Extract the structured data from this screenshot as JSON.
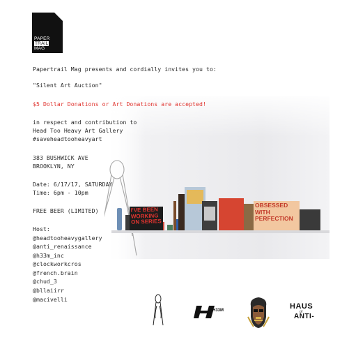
{
  "logo": {
    "line1": "PAPER",
    "line2": "TRAIL",
    "line3": "MAG"
  },
  "intro": "Papertrail Mag presents and cordially invites you to:",
  "event_title": "\"Silent Art Auction\"",
  "donation_note": "$5 Dollar Donations or Art Donations are accepted!",
  "purpose": [
    "in respect and contribution to",
    "Head Too Heavy Art Gallery",
    "#saveheadtooheavyart"
  ],
  "address": [
    "383 BUSHWICK AVE",
    "BROOKLYN, NY"
  ],
  "schedule": [
    "Date: 6/17/17, SATURDAY",
    "Time: 6pm - 10pm"
  ],
  "beer": "FREE BEER (LIMITED)",
  "hosts_label": "Host:",
  "hosts": [
    "@headtooheavygallery",
    "@anti_renaissance",
    "@h33m_inc",
    "@clockworkcros",
    "@french.brain",
    "@chud_3",
    "@bllaiirr",
    "@macivelli"
  ],
  "photo_signs": {
    "sign1": "I'VE BEEN WORKING ON SERIES",
    "sign2": "OBSESSED WITH PERFECTION"
  },
  "sponsors": {
    "h33m": "H33M",
    "haus": "HAUS",
    "of": "of",
    "anti": "ANTI-"
  },
  "colors": {
    "accent": "#e0342f",
    "text": "#2a2a2a",
    "logo_bg": "#111111"
  }
}
